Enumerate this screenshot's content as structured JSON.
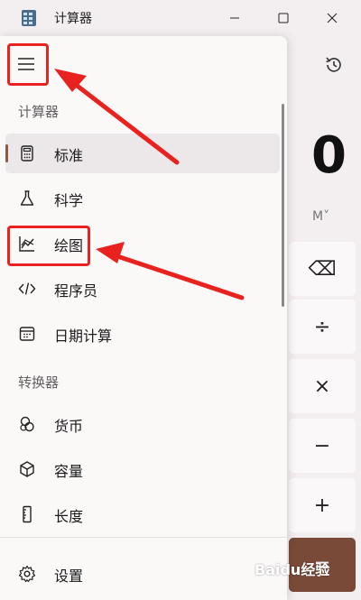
{
  "window": {
    "title": "计算器",
    "minimize_icon": "minimize-icon",
    "maximize_icon": "maximize-icon",
    "close_icon": "close-icon"
  },
  "nav": {
    "menu_icon": "hamburger-menu-icon",
    "section_calculator": "计算器",
    "calculators": [
      {
        "label": "标准",
        "icon": "calculator-icon",
        "selected": true
      },
      {
        "label": "科学",
        "icon": "flask-icon",
        "selected": false
      },
      {
        "label": "绘图",
        "icon": "graph-icon",
        "selected": false
      },
      {
        "label": "程序员",
        "icon": "code-icon",
        "selected": false
      },
      {
        "label": "日期计算",
        "icon": "calendar-icon",
        "selected": false
      }
    ],
    "section_converter": "转换器",
    "converters": [
      {
        "label": "货币",
        "icon": "currency-icon"
      },
      {
        "label": "容量",
        "icon": "cube-icon"
      },
      {
        "label": "长度",
        "icon": "ruler-icon"
      }
    ],
    "settings_label": "设置",
    "settings_icon": "gear-icon"
  },
  "calculator": {
    "display": "0",
    "memory_label": "M˅",
    "history_icon": "history-icon",
    "keys": [
      "⌫",
      "÷",
      "×",
      "−",
      "+",
      "="
    ]
  },
  "watermark": "Baidu经验",
  "colors": {
    "accent": "#8a5a44",
    "annotation": "#e8221f",
    "equals_key": "#7a4a39"
  }
}
